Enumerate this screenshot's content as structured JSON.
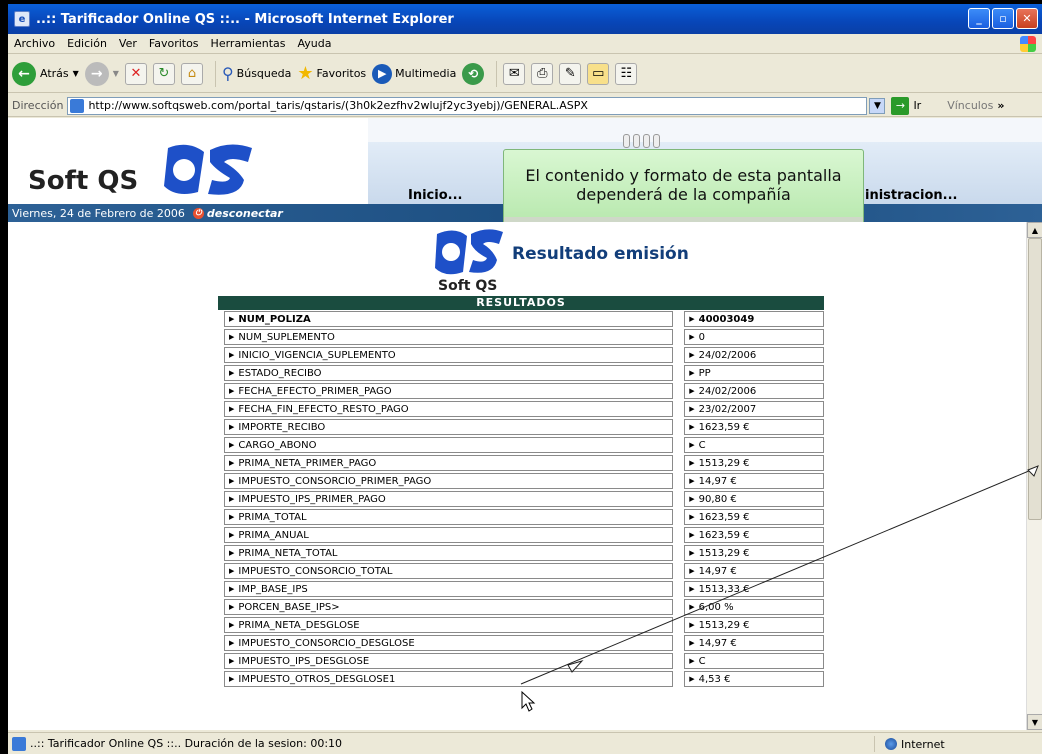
{
  "window": {
    "title": "..:: Tarificador Online QS ::.. - Microsoft Internet Explorer"
  },
  "menu": [
    "Archivo",
    "Edición",
    "Ver",
    "Favoritos",
    "Herramientas",
    "Ayuda"
  ],
  "toolbar": {
    "back": "Atrás",
    "search": "Búsqueda",
    "favorites": "Favoritos",
    "media": "Multimedia"
  },
  "address": {
    "label": "Dirección",
    "url": "http://www.softqsweb.com/portal_taris/qstaris/(3h0k2ezfhv2wlujf2yc3yebj)/GENERAL.ASPX",
    "go": "Ir",
    "links": "Vínculos"
  },
  "site": {
    "logo": "Soft QS",
    "nav_inicio": "Inicio...",
    "nav_admin": "inistracion...",
    "date": "Viernes, 24 de Febrero de 2006",
    "disconnect": "desconectar"
  },
  "tooltip": {
    "line1": "El contenido y formato de esta pantalla",
    "line2": "dependerá de la compañía"
  },
  "result": {
    "title": "Resultado emisión",
    "logo_text": "Soft QS",
    "table_header": "RESULTADOS"
  },
  "rows": [
    {
      "k": "NUM_POLIZA",
      "v": "40003049"
    },
    {
      "k": "NUM_SUPLEMENTO",
      "v": "0"
    },
    {
      "k": "INICIO_VIGENCIA_SUPLEMENTO",
      "v": "24/02/2006"
    },
    {
      "k": "ESTADO_RECIBO",
      "v": "PP"
    },
    {
      "k": "FECHA_EFECTO_PRIMER_PAGO",
      "v": "24/02/2006"
    },
    {
      "k": "FECHA_FIN_EFECTO_RESTO_PAGO",
      "v": "23/02/2007"
    },
    {
      "k": "IMPORTE_RECIBO",
      "v": "1623,59 €"
    },
    {
      "k": "CARGO_ABONO",
      "v": "C"
    },
    {
      "k": "PRIMA_NETA_PRIMER_PAGO",
      "v": "1513,29 €"
    },
    {
      "k": "IMPUESTO_CONSORCIO_PRIMER_PAGO",
      "v": "14,97 €"
    },
    {
      "k": "IMPUESTO_IPS_PRIMER_PAGO",
      "v": "90,80 €"
    },
    {
      "k": "PRIMA_TOTAL",
      "v": "1623,59 €"
    },
    {
      "k": "PRIMA_ANUAL",
      "v": "1623,59 €"
    },
    {
      "k": "PRIMA_NETA_TOTAL",
      "v": "1513,29 €"
    },
    {
      "k": "IMPUESTO_CONSORCIO_TOTAL",
      "v": "14,97 €"
    },
    {
      "k": "IMP_BASE_IPS",
      "v": "1513,33 €"
    },
    {
      "k": "PORCEN_BASE_IPS>",
      "v": "6,00 %"
    },
    {
      "k": "PRIMA_NETA_DESGLOSE",
      "v": "1513,29 €"
    },
    {
      "k": "IMPUESTO_CONSORCIO_DESGLOSE",
      "v": "14,97 €"
    },
    {
      "k": "IMPUESTO_IPS_DESGLOSE",
      "v": "C"
    },
    {
      "k": "IMPUESTO_OTROS_DESGLOSE1",
      "v": "4,53 €"
    }
  ],
  "status": {
    "text": "..:: Tarificador Online QS ::.. Duración de la sesion: 00:10",
    "zone": "Internet"
  }
}
